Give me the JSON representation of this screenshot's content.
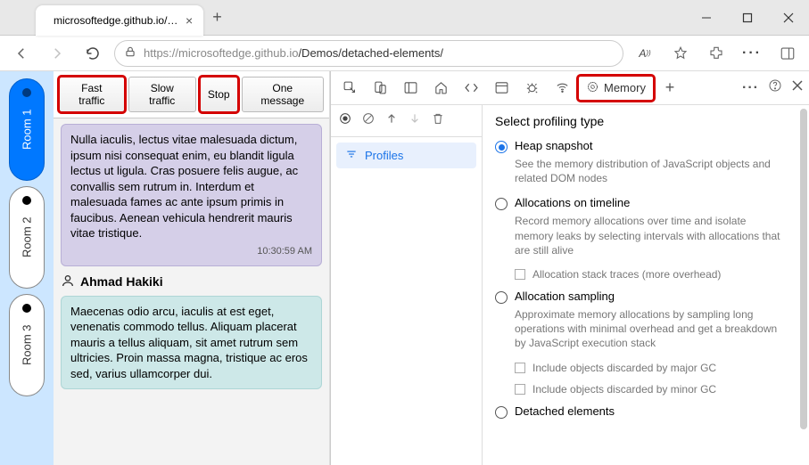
{
  "window": {
    "tab_title": "microsoftedge.github.io/Demos/c",
    "url_host": "https://microsoftedge.github.io",
    "url_path": "/Demos/detached-elements/"
  },
  "rooms": [
    {
      "label": "Room 1",
      "active": true
    },
    {
      "label": "Room 2",
      "active": false
    },
    {
      "label": "Room 3",
      "active": false
    }
  ],
  "traffic_buttons": {
    "fast": "Fast traffic",
    "slow": "Slow traffic",
    "stop": "Stop",
    "one": "One message"
  },
  "messages": {
    "m0": {
      "body": "Nulla iaculis, lectus vitae malesuada dictum, ipsum nisi consequat enim, eu blandit ligula lectus ut ligula. Cras posuere felis augue, ac convallis sem rutrum in. Interdum et malesuada fames ac ante ipsum primis in faucibus. Aenean vehicula hendrerit mauris vitae tristique.",
      "time": "10:30:59 AM"
    },
    "author1": "Ahmad Hakiki",
    "m1": {
      "body": "Maecenas odio arcu, iaculis at est eget, venenatis commodo tellus. Aliquam placerat mauris a tellus aliquam, sit amet rutrum sem ultricies. Proin massa magna, tristique ac eros sed, varius ullamcorper dui."
    }
  },
  "devtools": {
    "tab_memory": "Memory",
    "profiles_label": "Profiles",
    "title": "Select profiling type",
    "options": {
      "heap": {
        "label": "Heap snapshot",
        "desc": "See the memory distribution of JavaScript objects and related DOM nodes"
      },
      "timeline": {
        "label": "Allocations on timeline",
        "desc": "Record memory allocations over time and isolate memory leaks by selecting intervals with allocations that are still alive",
        "check1": "Allocation stack traces (more overhead)"
      },
      "sampling": {
        "label": "Allocation sampling",
        "desc": "Approximate memory allocations by sampling long operations with minimal overhead and get a breakdown by JavaScript execution stack",
        "check1": "Include objects discarded by major GC",
        "check2": "Include objects discarded by minor GC"
      },
      "detached": {
        "label": "Detached elements"
      }
    }
  }
}
